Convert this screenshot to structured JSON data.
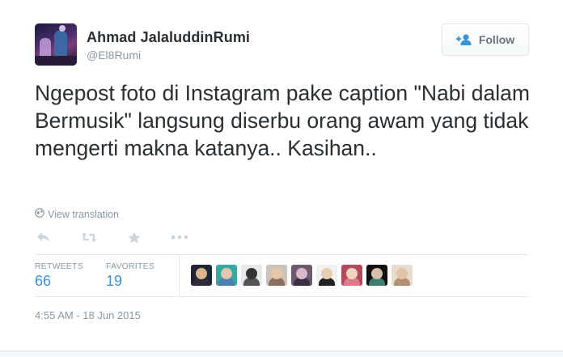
{
  "tweet": {
    "author": {
      "name": "Ahmad JalaluddinRumi",
      "handle": "@El8Rumi"
    },
    "follow_label": "Follow",
    "text": "Ngepost foto di Instagram pake caption \"Nabi dalam Bermusik\" langsung diserbu orang awam yang tidak mengerti makna katanya.. Kasihan..",
    "view_translation": "View translation",
    "actions": [
      "reply-icon",
      "retweet-icon",
      "favorite-icon",
      "more-icon"
    ],
    "stats": {
      "retweets_label": "RETWEETS",
      "retweets_value": "66",
      "favorites_label": "FAVORITES",
      "favorites_value": "19"
    },
    "favoriters": [
      {
        "bg": "#1e2433",
        "head": "#d9b48f",
        "body": "#2b2b3a"
      },
      {
        "bg": "#3aa6a0",
        "head": "#e0c7b0",
        "body": "#4a7fb0"
      },
      {
        "bg": "#e8e8e8",
        "head": "#333333",
        "body": "#555555"
      },
      {
        "bg": "#cfc2b8",
        "head": "#e6c6a8",
        "body": "#8a6f5e"
      },
      {
        "bg": "#6d5a70",
        "head": "#d7b9c9",
        "body": "#3a2f40"
      },
      {
        "bg": "#f2f2f2",
        "head": "#e9cdb0",
        "body": "#222222"
      },
      {
        "bg": "#b34a5a",
        "head": "#f0d3c0",
        "body": "#e07a8a"
      },
      {
        "bg": "#101010",
        "head": "#d8c0a8",
        "body": "#3a7f70"
      },
      {
        "bg": "#e8dccf",
        "head": "#e4c4a8",
        "body": "#b5906f"
      }
    ],
    "timestamp": "4:55 AM - 18 Jun 2015",
    "colors": {
      "link_blue": "#3b94d9",
      "muted": "#8899a6",
      "text": "#292f33"
    }
  }
}
